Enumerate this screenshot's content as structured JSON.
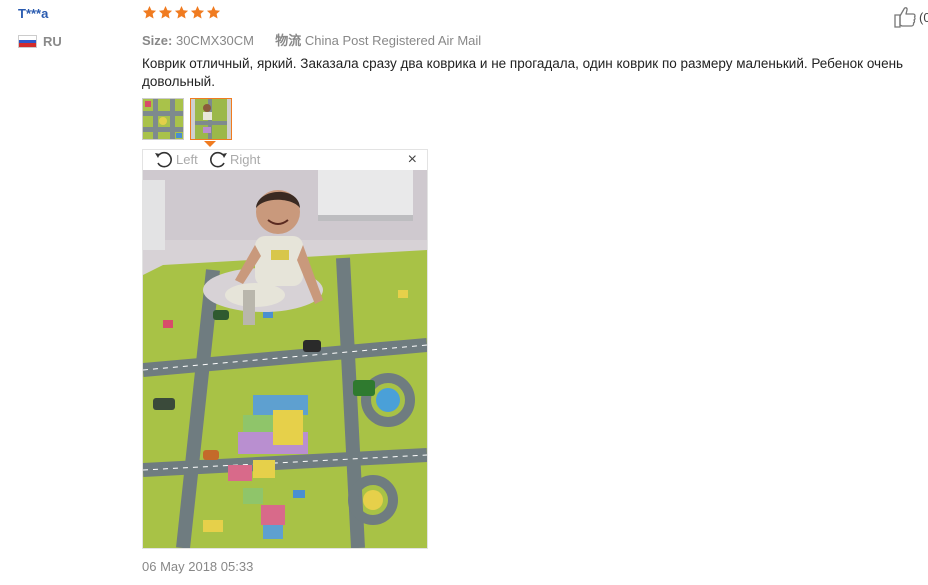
{
  "reviewer": {
    "name": "T***a",
    "country": "RU",
    "flag_icon": "russia-flag-icon"
  },
  "rating": {
    "stars": 5,
    "max": 5,
    "color": "#f07b20",
    "icon": "star-icon"
  },
  "helpful": {
    "icon": "thumbs-up-icon",
    "count_text": "(0"
  },
  "attributes": {
    "size_label": "Size:",
    "size_value": "30CMX30CM",
    "logistics_label": "物流",
    "logistics_value": "China Post Registered Air Mail"
  },
  "review": {
    "text": "Коврик отличный, яркий. Заказала сразу два коврика и не прогадала, один коврик по размеру маленький. Ребенок очень довольный."
  },
  "thumbnails": [
    {
      "name": "photo-thumbnail-1",
      "active": false
    },
    {
      "name": "photo-thumbnail-2",
      "active": true
    }
  ],
  "viewer": {
    "rotate_left_label": "Left",
    "rotate_right_label": "Right",
    "close_label": "×",
    "accent": "#f07b20"
  },
  "date": "06 May 2018 05:33"
}
